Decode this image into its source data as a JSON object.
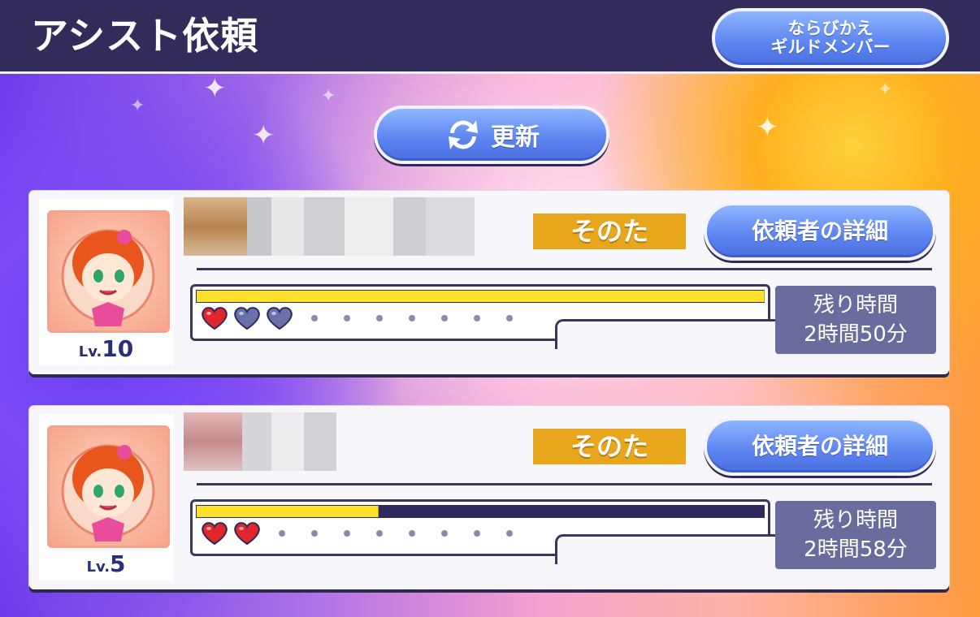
{
  "header": {
    "title": "アシスト依頼",
    "sort_button_line1": "ならびかえ",
    "sort_button_line2": "ギルドメンバー"
  },
  "refresh_button": {
    "label": "更新"
  },
  "requests": [
    {
      "level_prefix": "Lv.",
      "level": "10",
      "tag": "そのた",
      "detail_button": "依頼者の詳細",
      "progress": 1.0,
      "hearts_filled": 1,
      "hearts_empty": 2,
      "dots": 7,
      "time_label": "残り時間",
      "time_value": "2時間50分"
    },
    {
      "level_prefix": "Lv.",
      "level": "5",
      "tag": "そのた",
      "detail_button": "依頼者の詳細",
      "progress": 0.32,
      "hearts_filled": 2,
      "hearts_empty": 0,
      "dots": 8,
      "time_label": "残り時間",
      "time_value": "2時間58分"
    }
  ],
  "colors": {
    "header_bg": "#332c5b",
    "tag_bg": "#e7a61c",
    "bar_fill": "#ffe02a",
    "time_bg": "#6a6c9e",
    "heart_filled": "#e0262a",
    "heart_empty": "#6a70a8"
  }
}
